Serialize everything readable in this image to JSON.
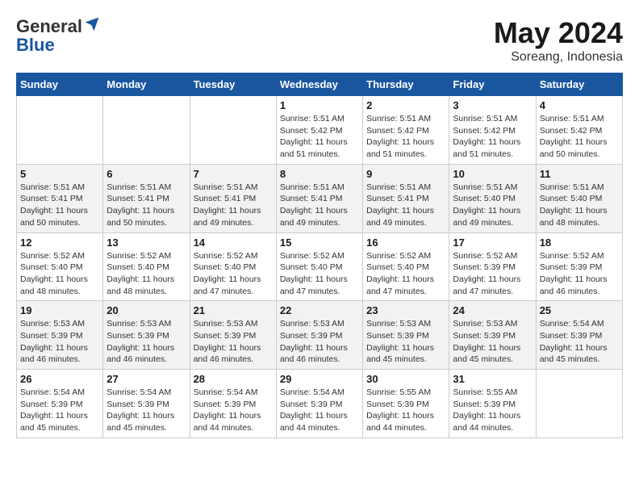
{
  "header": {
    "logo_line1": "General",
    "logo_line2": "Blue",
    "month": "May 2024",
    "location": "Soreang, Indonesia"
  },
  "weekdays": [
    "Sunday",
    "Monday",
    "Tuesday",
    "Wednesday",
    "Thursday",
    "Friday",
    "Saturday"
  ],
  "weeks": [
    [
      {
        "day": "",
        "info": ""
      },
      {
        "day": "",
        "info": ""
      },
      {
        "day": "",
        "info": ""
      },
      {
        "day": "1",
        "info": "Sunrise: 5:51 AM\nSunset: 5:42 PM\nDaylight: 11 hours\nand 51 minutes."
      },
      {
        "day": "2",
        "info": "Sunrise: 5:51 AM\nSunset: 5:42 PM\nDaylight: 11 hours\nand 51 minutes."
      },
      {
        "day": "3",
        "info": "Sunrise: 5:51 AM\nSunset: 5:42 PM\nDaylight: 11 hours\nand 51 minutes."
      },
      {
        "day": "4",
        "info": "Sunrise: 5:51 AM\nSunset: 5:42 PM\nDaylight: 11 hours\nand 50 minutes."
      }
    ],
    [
      {
        "day": "5",
        "info": "Sunrise: 5:51 AM\nSunset: 5:41 PM\nDaylight: 11 hours\nand 50 minutes."
      },
      {
        "day": "6",
        "info": "Sunrise: 5:51 AM\nSunset: 5:41 PM\nDaylight: 11 hours\nand 50 minutes."
      },
      {
        "day": "7",
        "info": "Sunrise: 5:51 AM\nSunset: 5:41 PM\nDaylight: 11 hours\nand 49 minutes."
      },
      {
        "day": "8",
        "info": "Sunrise: 5:51 AM\nSunset: 5:41 PM\nDaylight: 11 hours\nand 49 minutes."
      },
      {
        "day": "9",
        "info": "Sunrise: 5:51 AM\nSunset: 5:41 PM\nDaylight: 11 hours\nand 49 minutes."
      },
      {
        "day": "10",
        "info": "Sunrise: 5:51 AM\nSunset: 5:40 PM\nDaylight: 11 hours\nand 49 minutes."
      },
      {
        "day": "11",
        "info": "Sunrise: 5:51 AM\nSunset: 5:40 PM\nDaylight: 11 hours\nand 48 minutes."
      }
    ],
    [
      {
        "day": "12",
        "info": "Sunrise: 5:52 AM\nSunset: 5:40 PM\nDaylight: 11 hours\nand 48 minutes."
      },
      {
        "day": "13",
        "info": "Sunrise: 5:52 AM\nSunset: 5:40 PM\nDaylight: 11 hours\nand 48 minutes."
      },
      {
        "day": "14",
        "info": "Sunrise: 5:52 AM\nSunset: 5:40 PM\nDaylight: 11 hours\nand 47 minutes."
      },
      {
        "day": "15",
        "info": "Sunrise: 5:52 AM\nSunset: 5:40 PM\nDaylight: 11 hours\nand 47 minutes."
      },
      {
        "day": "16",
        "info": "Sunrise: 5:52 AM\nSunset: 5:40 PM\nDaylight: 11 hours\nand 47 minutes."
      },
      {
        "day": "17",
        "info": "Sunrise: 5:52 AM\nSunset: 5:39 PM\nDaylight: 11 hours\nand 47 minutes."
      },
      {
        "day": "18",
        "info": "Sunrise: 5:52 AM\nSunset: 5:39 PM\nDaylight: 11 hours\nand 46 minutes."
      }
    ],
    [
      {
        "day": "19",
        "info": "Sunrise: 5:53 AM\nSunset: 5:39 PM\nDaylight: 11 hours\nand 46 minutes."
      },
      {
        "day": "20",
        "info": "Sunrise: 5:53 AM\nSunset: 5:39 PM\nDaylight: 11 hours\nand 46 minutes."
      },
      {
        "day": "21",
        "info": "Sunrise: 5:53 AM\nSunset: 5:39 PM\nDaylight: 11 hours\nand 46 minutes."
      },
      {
        "day": "22",
        "info": "Sunrise: 5:53 AM\nSunset: 5:39 PM\nDaylight: 11 hours\nand 46 minutes."
      },
      {
        "day": "23",
        "info": "Sunrise: 5:53 AM\nSunset: 5:39 PM\nDaylight: 11 hours\nand 45 minutes."
      },
      {
        "day": "24",
        "info": "Sunrise: 5:53 AM\nSunset: 5:39 PM\nDaylight: 11 hours\nand 45 minutes."
      },
      {
        "day": "25",
        "info": "Sunrise: 5:54 AM\nSunset: 5:39 PM\nDaylight: 11 hours\nand 45 minutes."
      }
    ],
    [
      {
        "day": "26",
        "info": "Sunrise: 5:54 AM\nSunset: 5:39 PM\nDaylight: 11 hours\nand 45 minutes."
      },
      {
        "day": "27",
        "info": "Sunrise: 5:54 AM\nSunset: 5:39 PM\nDaylight: 11 hours\nand 45 minutes."
      },
      {
        "day": "28",
        "info": "Sunrise: 5:54 AM\nSunset: 5:39 PM\nDaylight: 11 hours\nand 44 minutes."
      },
      {
        "day": "29",
        "info": "Sunrise: 5:54 AM\nSunset: 5:39 PM\nDaylight: 11 hours\nand 44 minutes."
      },
      {
        "day": "30",
        "info": "Sunrise: 5:55 AM\nSunset: 5:39 PM\nDaylight: 11 hours\nand 44 minutes."
      },
      {
        "day": "31",
        "info": "Sunrise: 5:55 AM\nSunset: 5:39 PM\nDaylight: 11 hours\nand 44 minutes."
      },
      {
        "day": "",
        "info": ""
      }
    ]
  ]
}
